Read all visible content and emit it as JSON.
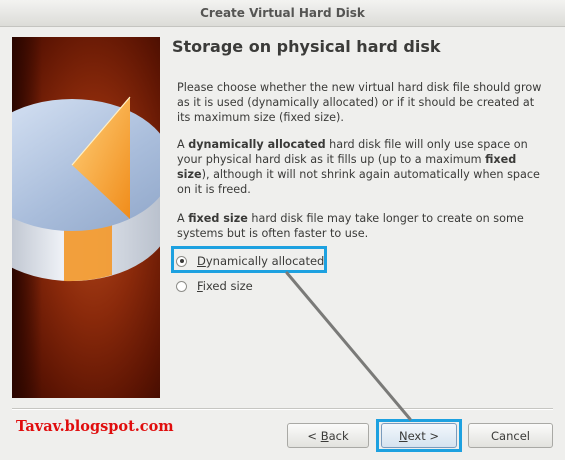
{
  "window": {
    "title": "Create Virtual Hard Disk"
  },
  "page": {
    "heading": "Storage on physical hard disk",
    "intro": "Please choose whether the new virtual hard disk file should grow as it is used (dynamically allocated) or if it should be created at its maximum size (fixed size).",
    "dynamic_paragraph": {
      "pre": "A ",
      "term": "dynamically allocated",
      "mid": " hard disk file will only use space on your physical hard disk as it fills up (up to a maximum ",
      "term2": "fixed size",
      "post": "), although it will not shrink again automatically when space on it is freed."
    },
    "fixed_paragraph": {
      "pre": "A ",
      "term": "fixed size",
      "post": " hard disk file may take longer to create on some systems but is often faster to use."
    }
  },
  "options": [
    {
      "label": "Dynamically allocated",
      "mnemonic": "D",
      "rest": "ynamically allocated",
      "selected": true
    },
    {
      "label": "Fixed size",
      "mnemonic": "F",
      "rest": "ixed size",
      "selected": false
    }
  ],
  "buttons": {
    "back": {
      "pre": "< ",
      "mnemonic": "B",
      "rest": "ack"
    },
    "next": {
      "mnemonic": "N",
      "rest": "ext >"
    },
    "cancel": {
      "label": "Cancel"
    }
  },
  "watermark": "Tavav.blogspot.com",
  "colors": {
    "highlight": "#1da1e0",
    "annotation_line": "#7a7a78",
    "watermark": "#e00d0d",
    "panel_bg": "#8b2a0b"
  },
  "icons": {
    "side_graphic": "hard-disk-pie-icon"
  }
}
